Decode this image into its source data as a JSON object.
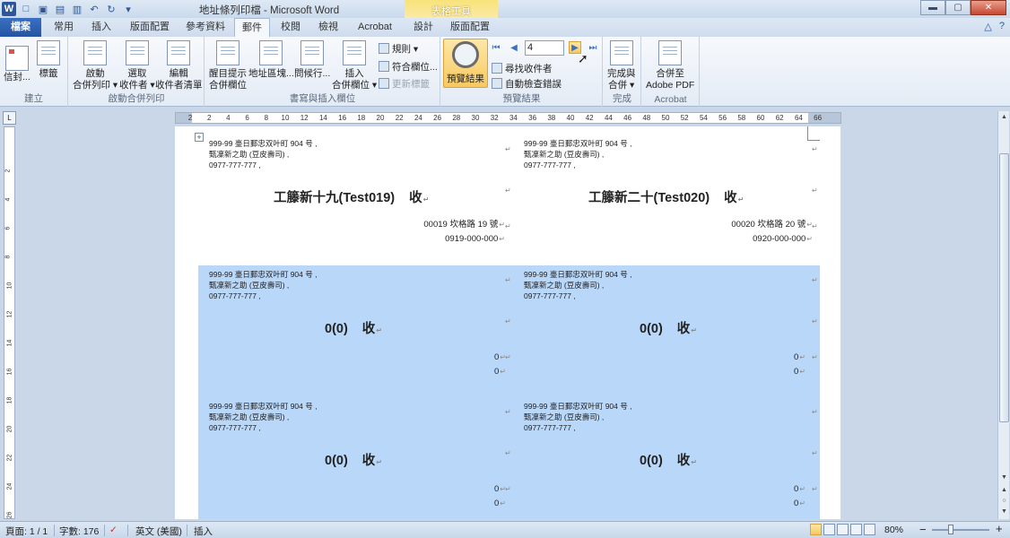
{
  "window": {
    "title": "地址條列印檔 - Microsoft Word",
    "context_group": "表格工具",
    "minimize": "▬",
    "maximize": "▢",
    "close": "✕"
  },
  "qat": {
    "app": "W",
    "new": "□",
    "open": "▣",
    "save": "▤",
    "print": "▥",
    "undo": "↶",
    "redo": "↻",
    "customize": "▾"
  },
  "tabs": [
    {
      "label": "檔案"
    },
    {
      "label": "常用"
    },
    {
      "label": "插入"
    },
    {
      "label": "版面配置"
    },
    {
      "label": "參考資料"
    },
    {
      "label": "郵件"
    },
    {
      "label": "校閱"
    },
    {
      "label": "檢視"
    },
    {
      "label": "Acrobat"
    },
    {
      "label": "設計"
    },
    {
      "label": "版面配置"
    }
  ],
  "help": {
    "minimize_ribbon": "△",
    "help": "?"
  },
  "ribbon": {
    "create": {
      "label": "建立",
      "envelopes": "信封...",
      "labels": "標籤"
    },
    "start": {
      "label": "啟動合併列印",
      "start_merge": [
        "啟動",
        "合併列印 ▾"
      ],
      "select_recipients": [
        "選取",
        "收件者 ▾"
      ],
      "edit_list": [
        "編輯",
        "收件者清單"
      ]
    },
    "write": {
      "label": "書寫與插入欄位",
      "highlight": [
        "醒目提示",
        "合併欄位"
      ],
      "address_block": "地址區塊...",
      "greeting": "問候行...",
      "insert_field": [
        "插入",
        "合併欄位 ▾"
      ],
      "rules": "規則 ▾",
      "match_fields": "符合欄位...",
      "update_labels": "更新標籤"
    },
    "preview": {
      "label": "預覽結果",
      "preview_btn": "預覽結果",
      "record": "4",
      "find_recipient": "尋找收件者",
      "auto_check": "自動檢查錯誤",
      "first": "⏮",
      "prev": "◀",
      "next": "▶",
      "last": "⏭"
    },
    "finish": {
      "label": "完成",
      "finish_merge": [
        "完成與",
        "合併 ▾"
      ]
    },
    "acrobat": {
      "label": "Acrobat",
      "merge_pdf": [
        "合併至",
        "Adobe PDF"
      ]
    }
  },
  "ruler": {
    "h_ticks": [
      "2",
      "2",
      "4",
      "6",
      "8",
      "10",
      "12",
      "14",
      "16",
      "18",
      "20",
      "22",
      "24",
      "26",
      "28",
      "30",
      "32",
      "34",
      "36",
      "38",
      "40",
      "42",
      "44",
      "46",
      "48",
      "50",
      "52",
      "54",
      "56",
      "58",
      "60",
      "62",
      "64",
      "66"
    ],
    "v_ticks": [
      "2",
      "4",
      "6",
      "8",
      "10",
      "12",
      "14",
      "16",
      "18",
      "20",
      "22",
      "24",
      "26"
    ]
  },
  "sender": {
    "line1": "999-99 臺日郵忠双叶町 904 号 ,",
    "line2": "甄凜新之助 (豆皮壽司) ,",
    "line3": "0977-777-777 ,"
  },
  "labels": [
    {
      "recipient": "工籐新十九(Test019)",
      "shou": "收",
      "address": "00019 坎格路 19 號",
      "phone": "0919-000-000"
    },
    {
      "recipient": "工籐新二十(Test020)",
      "shou": "收",
      "address": "00020 坎格路 20 號",
      "phone": "0920-000-000"
    },
    {
      "recipient": "0(0)",
      "shou": "收",
      "address": "0",
      "phone": "0"
    },
    {
      "recipient": "0(0)",
      "shou": "收",
      "address": "0",
      "phone": "0"
    },
    {
      "recipient": "0(0)",
      "shou": "收",
      "address": "0",
      "phone": "0"
    },
    {
      "recipient": "0(0)",
      "shou": "收",
      "address": "0",
      "phone": "0"
    }
  ],
  "marks": {
    "para": "↵",
    "cell": "¤"
  },
  "status": {
    "page": "頁面: 1 / 1",
    "words": "字數: 176",
    "language": "英文 (美國)",
    "mode": "插入",
    "zoom": "80%",
    "zoom_out": "−",
    "zoom_in": "+"
  },
  "scroll": {
    "up": "▲",
    "down": "▼",
    "prev_page": "▲",
    "select": "○",
    "next_page": "▼"
  }
}
